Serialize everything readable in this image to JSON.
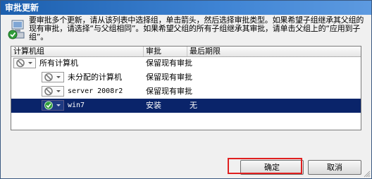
{
  "window": {
    "title": "审批更新"
  },
  "instructions": "要审批多个更新，请从该列表中选择组，单击箭头，然后选择审批类型。如果希望子组继承其父组的现有审批，请选择“与父组相同”。如果希望父组的所有子组继承其审批，请单击父组上的“应用到子组”。",
  "columns": {
    "group": "计算机组",
    "approval": "审批",
    "deadline": "最后期限"
  },
  "rows": [
    {
      "name": "所有计算机",
      "approval": "保留现有审批",
      "deadline": "",
      "status": "not-approved"
    },
    {
      "name": "未分配的计算机",
      "approval": "保留现有审批",
      "deadline": "",
      "status": "not-approved"
    },
    {
      "name": "server 2008r2",
      "approval": "保留现有审批",
      "deadline": "",
      "status": "not-approved"
    },
    {
      "name": "win7",
      "approval": "安装",
      "deadline": "无",
      "status": "approved-install",
      "selected": true
    }
  ],
  "buttons": {
    "ok": "确定",
    "cancel": "取消"
  },
  "colors": {
    "selection": "#0a246a",
    "highlight_ring": "#e02020",
    "titlebar": "#1c5fae"
  }
}
